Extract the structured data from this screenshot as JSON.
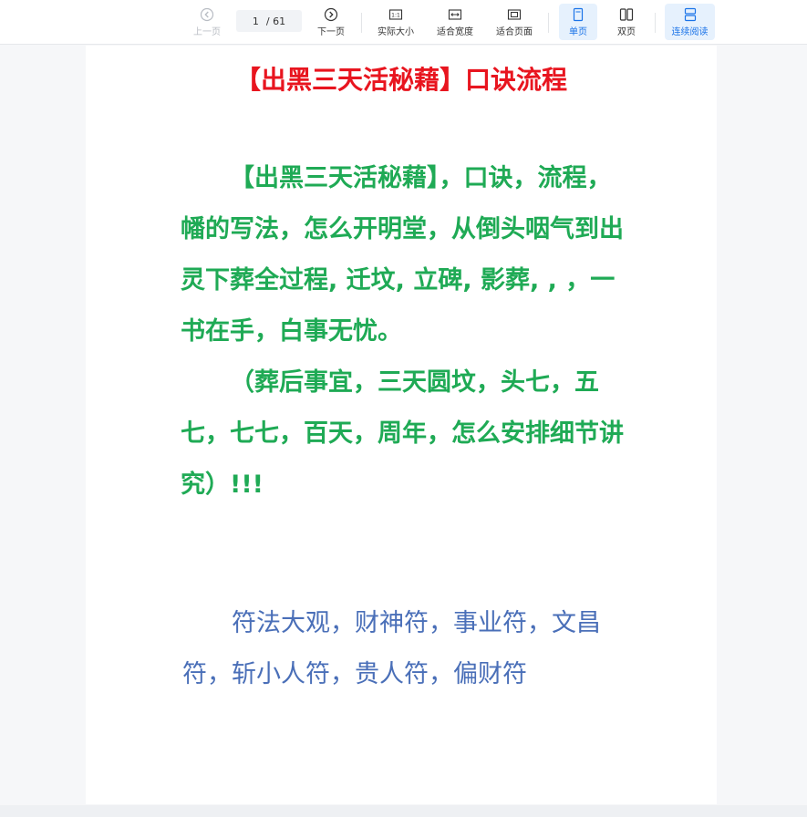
{
  "toolbar": {
    "prev_label": "上一页",
    "next_label": "下一页",
    "current_page": "1",
    "total_pages": "/ 61",
    "actual_size_label": "实际大小",
    "fit_width_label": "适合宽度",
    "fit_page_label": "适合页面",
    "single_page_label": "单页",
    "double_page_label": "双页",
    "continuous_label": "连续阅读",
    "actual_size_icon_text": "1:1"
  },
  "document": {
    "title": "【出黑三天活秘藉】口诀流程",
    "green_paragraphs": [
      "【出黑三天活秘藉】，口诀，流程，幡的写法，怎么开明堂，从倒头咽气到出灵下葬全过程, 迁坟, 立碑, 影葬, , ，一书在手，白事无忧。",
      "（葬后事宜，三天圆坟，头七，五七，七七，百天，周年，怎么安排细节讲究）!!!"
    ],
    "blue_paragraphs": [
      "符法大观，财神符，事业符，文昌符，斩小人符，贵人符，偏财符"
    ]
  },
  "colors": {
    "title": "#e8151f",
    "green_text": "#1faa55",
    "blue_text": "#4a6fb8",
    "active_blue": "#1a73e8"
  },
  "icons": {
    "prev": "chevron-left-circle-icon",
    "next": "chevron-right-circle-icon",
    "actual_size": "actual-size-icon",
    "fit_width": "fit-width-icon",
    "fit_page": "fit-page-icon",
    "single_page": "single-page-icon",
    "double_page": "double-page-icon",
    "continuous": "continuous-read-icon"
  }
}
